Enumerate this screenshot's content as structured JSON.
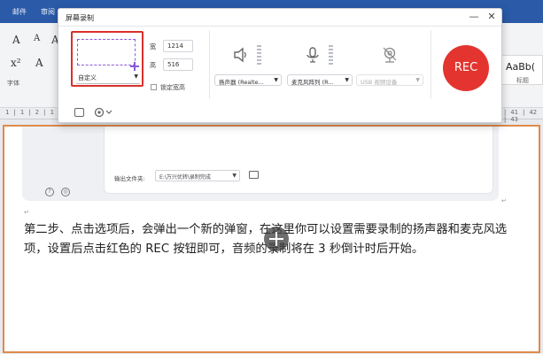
{
  "background_app": {
    "tabs": [
      "邮件",
      "审阅"
    ],
    "ribbon_glyphs": [
      "A",
      "A",
      "A",
      "x²",
      "A"
    ],
    "group_label": "字体",
    "style_sample": "AaBb(",
    "style_label": "标题",
    "ruler_left": "1 | 1 | 2 | 1",
    "ruler_right": "| 41 | 42 | 43"
  },
  "embedded_screenshot": {
    "output_label": "输出文件夹:",
    "output_path": "E:\\万兴优转\\录制完成"
  },
  "document": {
    "paragraph": "第二步、点击选项后，会弹出一个新的弹窗，在这里你可以设置需要录制的扬声器和麦克风选项，设置后点击红色的 REC 按钮即可，音频的录制将在 3 秒倒计时后开始。"
  },
  "dialog": {
    "title": "屏幕录制",
    "minimize": "—",
    "close": "✕",
    "mode": "自定义",
    "width_label": "宽",
    "width_value": "1214",
    "height_label": "高",
    "height_value": "516",
    "lock_label": "锁定宽高",
    "speaker": "扬声器 (Realte...",
    "microphone": "麦克风阵列 (R...",
    "camera": "USB 视频设备",
    "rec_label": "REC"
  }
}
